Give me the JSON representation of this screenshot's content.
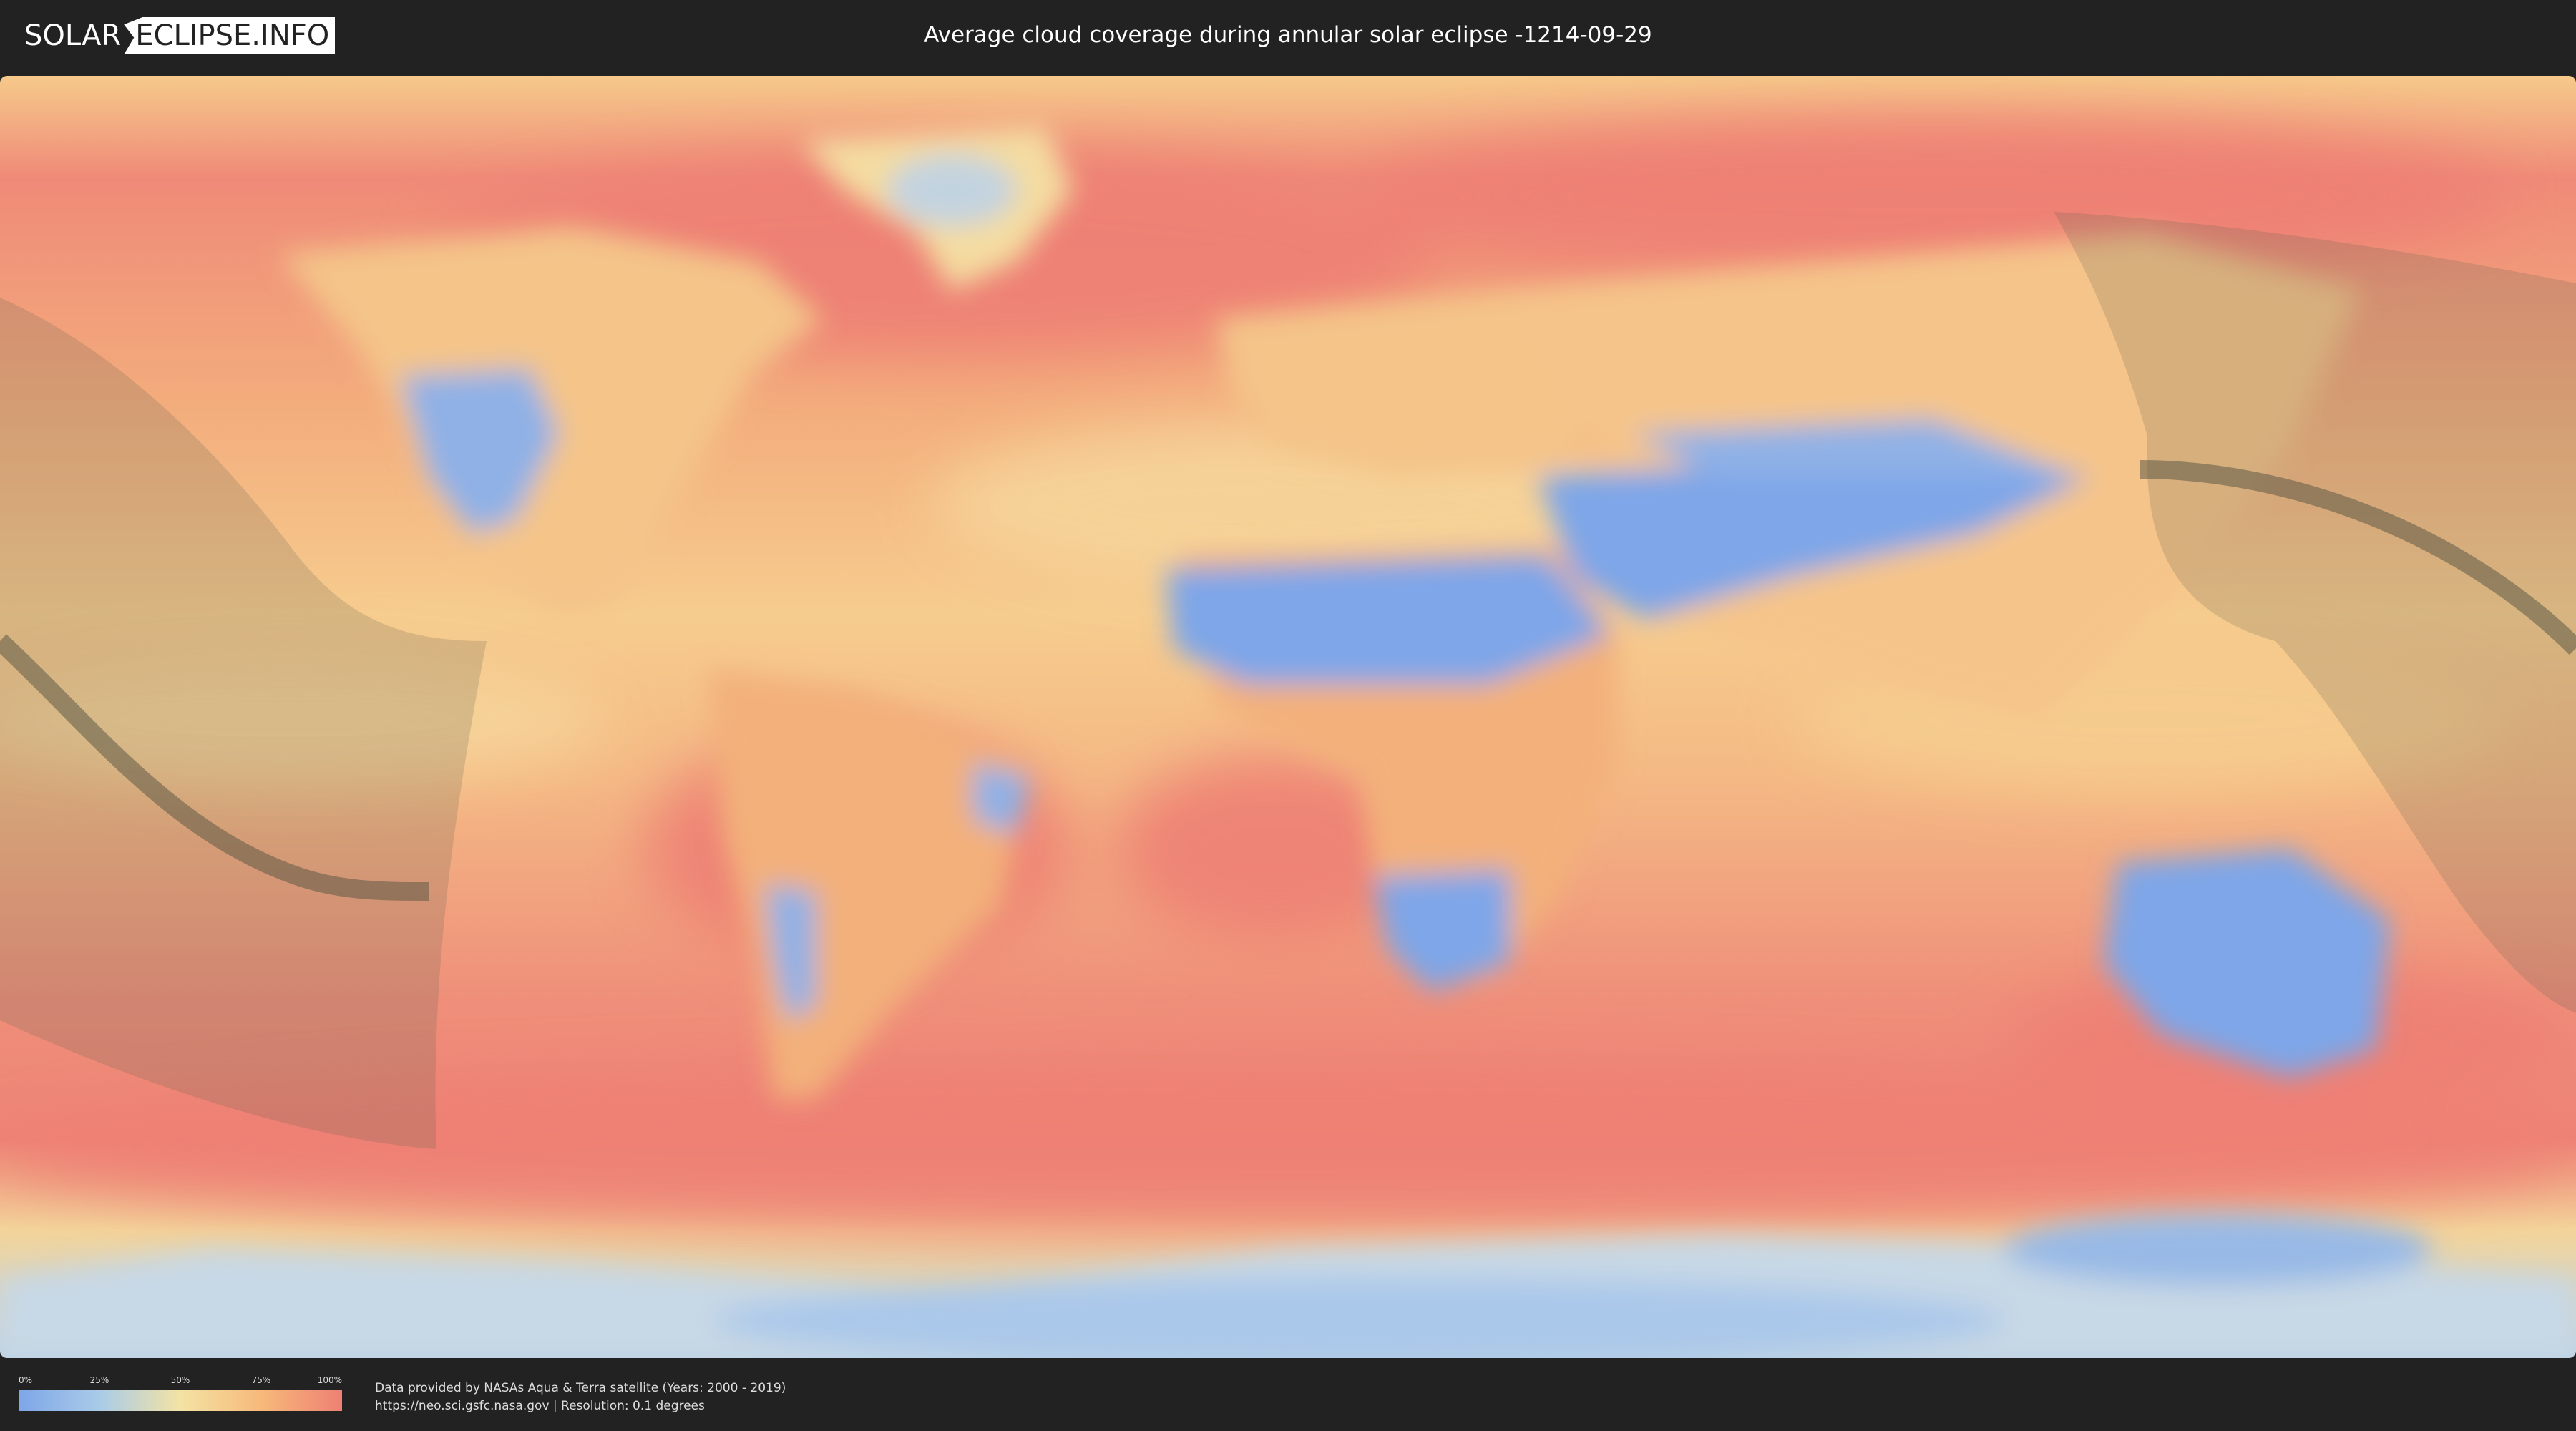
{
  "header": {
    "logo": {
      "left_text": "SOLAR",
      "right_text": "ECLIPSE.INFO"
    },
    "title": "Average cloud coverage during annular solar eclipse -1214-09-29"
  },
  "map": {
    "kind": "world cloud coverage equirectangular map",
    "colors": {
      "clear": "#7ea6e8",
      "low": "#a9cbe8",
      "mid": "#f3e3a4",
      "high": "#f7b97a",
      "full": "#ee8074",
      "shadow_overlay": "#6b6650",
      "central_line": "#5f5a45"
    }
  },
  "legend": {
    "ticks": [
      "0%",
      "25%",
      "50%",
      "75%",
      "100%"
    ],
    "tick_fractions": [
      0,
      0.25,
      0.5,
      0.75,
      1
    ],
    "gradient": [
      "#7ea6e8",
      "#a9cbe8",
      "#f3e3a4",
      "#f7b97a",
      "#ee8074"
    ]
  },
  "credits": {
    "line1": "Data provided by NASAs Aqua & Terra satellite (Years: 2000 - 2019)",
    "line2": "https://neo.sci.gsfc.nasa.gov | Resolution: 0.1 degrees"
  }
}
